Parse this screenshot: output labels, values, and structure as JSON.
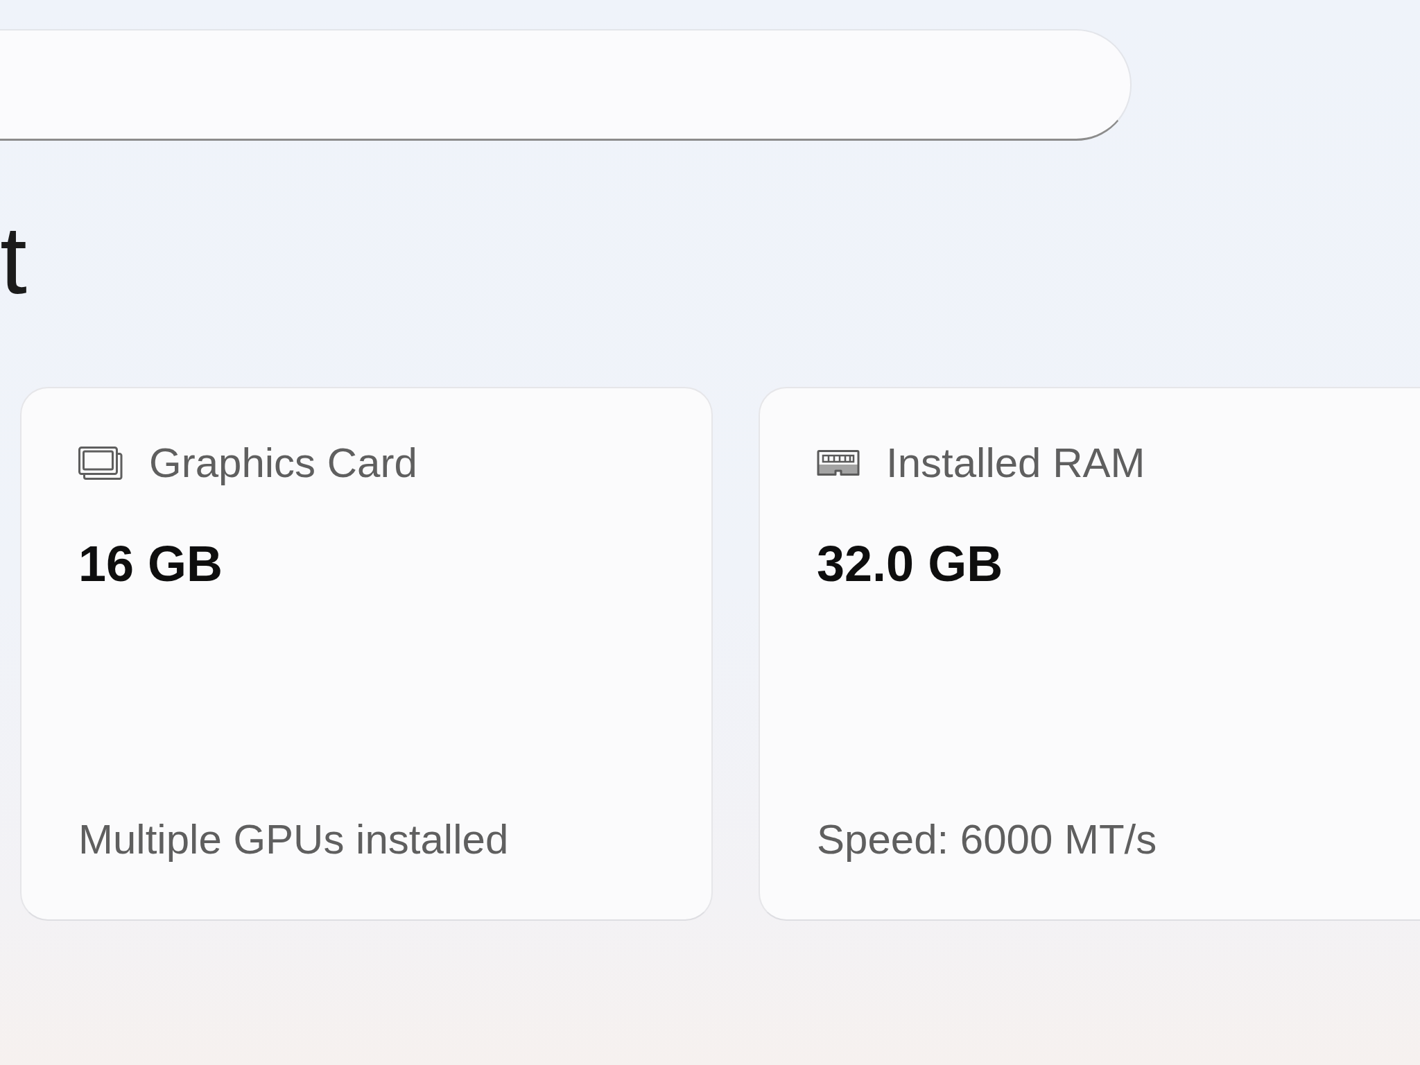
{
  "page_title": "t",
  "cards": [
    {
      "kind": "graphics",
      "label": "Graphics Card",
      "value": "16 GB",
      "detail": "Multiple GPUs installed"
    },
    {
      "kind": "memory",
      "label": "Installed RAM",
      "value": "32.0 GB",
      "detail": "Speed: 6000 MT/s"
    }
  ]
}
